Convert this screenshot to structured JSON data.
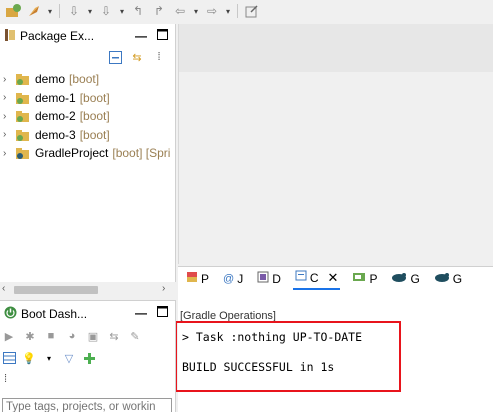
{
  "toolbar": {
    "icons": [
      "open-perspective-icon",
      "run-boot-icon",
      "nav-down-icon",
      "nav-next-icon",
      "back-icon",
      "forward-icon",
      "back-arrow-icon",
      "forward-arrow-icon",
      "edit-icon"
    ]
  },
  "package_explorer": {
    "title": "Package Ex...",
    "projects": [
      {
        "name": "demo",
        "decoration": "[boot]"
      },
      {
        "name": "demo-1",
        "decoration": "[boot]"
      },
      {
        "name": "demo-2",
        "decoration": "[boot]"
      },
      {
        "name": "demo-3",
        "decoration": "[boot]"
      },
      {
        "name": "GradleProject",
        "decoration": "[boot] [Spri"
      }
    ]
  },
  "bottom_tabs": [
    {
      "label": "P",
      "icon": "problems-icon"
    },
    {
      "label": "J",
      "icon": "javadoc-icon"
    },
    {
      "label": "D",
      "icon": "declaration-icon"
    },
    {
      "label": "C",
      "icon": "console-icon",
      "active": true
    },
    {
      "label": "P",
      "icon": "progress-icon"
    },
    {
      "label": "G",
      "icon": "gradle-tasks-icon"
    },
    {
      "label": "G",
      "icon": "gradle-executions-icon"
    }
  ],
  "console": {
    "title": "[Gradle Operations]",
    "lines": [
      "> Task :nothing UP-TO-DATE",
      "",
      "BUILD SUCCESSFUL in 1s"
    ]
  },
  "boot_dashboard": {
    "title": "Boot Dash...",
    "filter_placeholder": "Type tags, projects, or workin"
  },
  "colors": {
    "highlight_border": "#e8141c",
    "decoration": "#9a7f53"
  }
}
